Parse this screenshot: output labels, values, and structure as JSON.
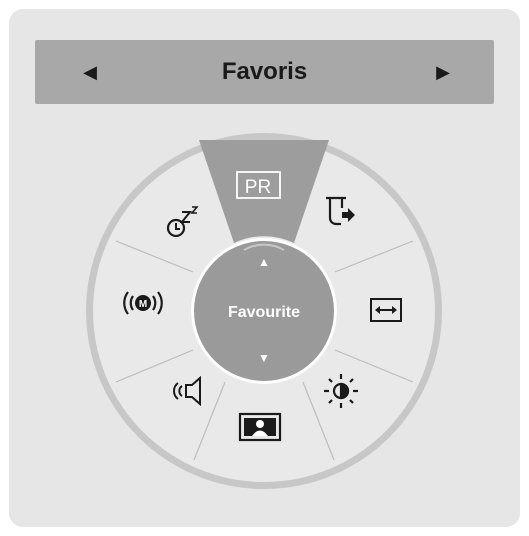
{
  "header": {
    "title": "Favoris",
    "prev_arrow": "◀",
    "next_arrow": "▶"
  },
  "wheel": {
    "center": {
      "label": "Favourite",
      "up_arrow": "▲",
      "down_arrow": "▼"
    },
    "items": [
      {
        "id": "pr",
        "icon": "pr-icon",
        "label": "PR",
        "selected": true
      },
      {
        "id": "input",
        "icon": "input-source-icon"
      },
      {
        "id": "aspect",
        "icon": "aspect-ratio-icon"
      },
      {
        "id": "brightness",
        "icon": "brightness-icon"
      },
      {
        "id": "picture",
        "icon": "picture-mode-icon"
      },
      {
        "id": "sound",
        "icon": "sound-mode-icon"
      },
      {
        "id": "mts",
        "icon": "mts-audio-icon",
        "label": "M"
      },
      {
        "id": "sleep",
        "icon": "sleep-timer-icon",
        "label": "z z"
      }
    ]
  },
  "colors": {
    "panel": "#e6e6e6",
    "header": "#a8a8a8",
    "wheel_face": "#e9e9e9",
    "wheel_rim": "#c4c4c4",
    "selected_segment": "#9d9d9d",
    "center_hub": "#9a9a9a"
  }
}
